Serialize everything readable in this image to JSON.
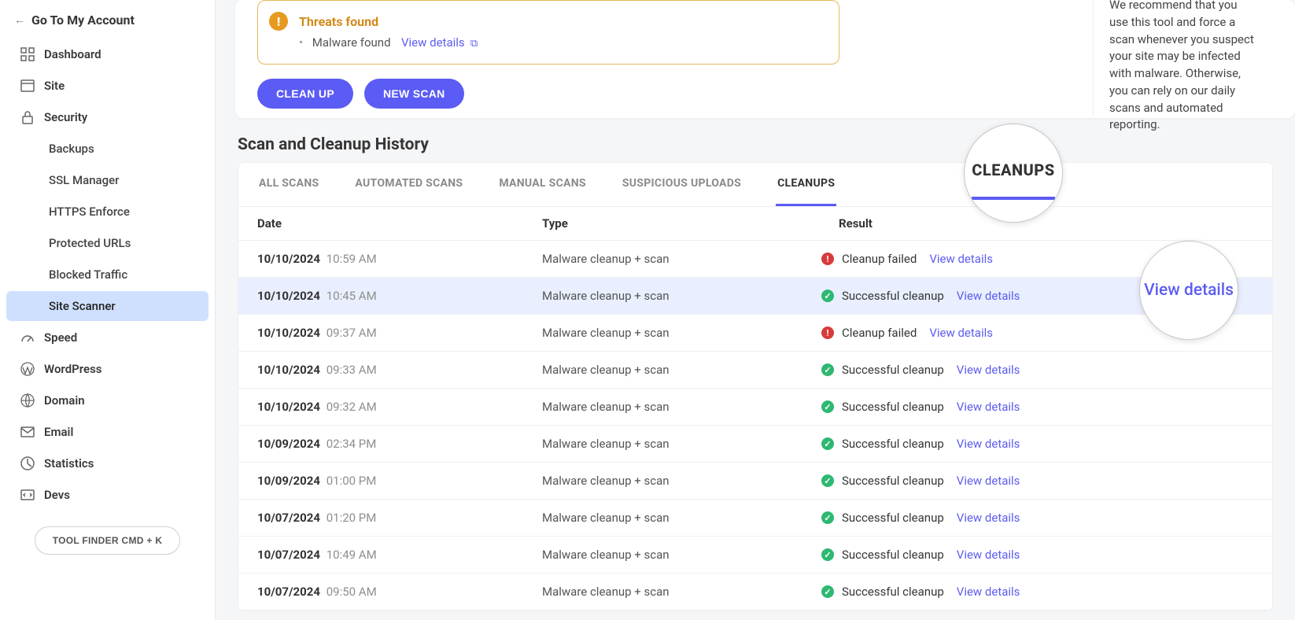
{
  "sidebar": {
    "back": "Go To My Account",
    "items": [
      {
        "label": "Dashboard",
        "icon": "dashboard"
      },
      {
        "label": "Site",
        "icon": "site"
      },
      {
        "label": "Security",
        "icon": "lock"
      },
      {
        "label": "Speed",
        "icon": "gauge"
      },
      {
        "label": "WordPress",
        "icon": "wp"
      },
      {
        "label": "Domain",
        "icon": "globe"
      },
      {
        "label": "Email",
        "icon": "mail"
      },
      {
        "label": "Statistics",
        "icon": "stats"
      },
      {
        "label": "Devs",
        "icon": "devs"
      }
    ],
    "security_children": [
      "Backups",
      "SSL Manager",
      "HTTPS Enforce",
      "Protected URLs",
      "Blocked Traffic",
      "Site Scanner"
    ],
    "tool_finder": "TOOL FINDER CMD + K"
  },
  "threat": {
    "title": "Threats found",
    "line": "Malware found",
    "view": "View details"
  },
  "buttons": {
    "cleanup": "CLEAN UP",
    "newscan": "NEW SCAN"
  },
  "right_text": "We recommend that you use this tool and force a scan whenever you suspect your site may be infected with malware. Otherwise, you can rely on our daily scans and automated reporting.",
  "history": {
    "title": "Scan and Cleanup History",
    "tabs": [
      "ALL SCANS",
      "AUTOMATED SCANS",
      "MANUAL SCANS",
      "SUSPICIOUS UPLOADS",
      "CLEANUPS"
    ],
    "headers": {
      "date": "Date",
      "type": "Type",
      "result": "Result"
    },
    "view_details": "View details",
    "rows": [
      {
        "date": "10/10/2024",
        "time": "10:59 AM",
        "type": "Malware cleanup + scan",
        "status": "Cleanup failed",
        "ok": false,
        "highlight": false
      },
      {
        "date": "10/10/2024",
        "time": "10:45 AM",
        "type": "Malware cleanup + scan",
        "status": "Successful cleanup",
        "ok": true,
        "highlight": true
      },
      {
        "date": "10/10/2024",
        "time": "09:37 AM",
        "type": "Malware cleanup + scan",
        "status": "Cleanup failed",
        "ok": false,
        "highlight": false
      },
      {
        "date": "10/10/2024",
        "time": "09:33 AM",
        "type": "Malware cleanup + scan",
        "status": "Successful cleanup",
        "ok": true,
        "highlight": false
      },
      {
        "date": "10/10/2024",
        "time": "09:32 AM",
        "type": "Malware cleanup + scan",
        "status": "Successful cleanup",
        "ok": true,
        "highlight": false
      },
      {
        "date": "10/09/2024",
        "time": "02:34 PM",
        "type": "Malware cleanup + scan",
        "status": "Successful cleanup",
        "ok": true,
        "highlight": false
      },
      {
        "date": "10/09/2024",
        "time": "01:00 PM",
        "type": "Malware cleanup + scan",
        "status": "Successful cleanup",
        "ok": true,
        "highlight": false
      },
      {
        "date": "10/07/2024",
        "time": "01:20 PM",
        "type": "Malware cleanup + scan",
        "status": "Successful cleanup",
        "ok": true,
        "highlight": false
      },
      {
        "date": "10/07/2024",
        "time": "10:49 AM",
        "type": "Malware cleanup + scan",
        "status": "Successful cleanup",
        "ok": true,
        "highlight": false
      },
      {
        "date": "10/07/2024",
        "time": "09:50 AM",
        "type": "Malware cleanup + scan",
        "status": "Successful cleanup",
        "ok": true,
        "highlight": false
      }
    ]
  },
  "mag": {
    "tab": "CLEANUPS",
    "link": "View details"
  }
}
